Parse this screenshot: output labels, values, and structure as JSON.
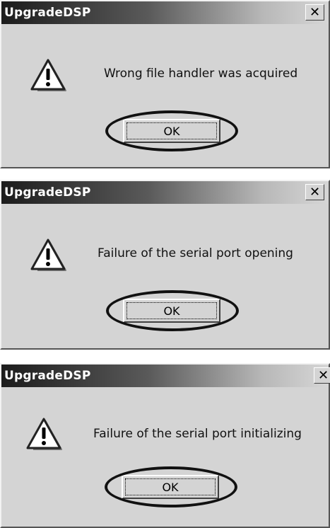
{
  "dialogs": [
    {
      "title": "UpgradeDSP",
      "message": "Wrong file handler was acquired",
      "ok_label": "OK",
      "close_label": "✕"
    },
    {
      "title": "UpgradeDSP",
      "message": "Failure of the serial port opening",
      "ok_label": "OK",
      "close_label": "✕"
    },
    {
      "title": "UpgradeDSP",
      "message": "Failure of the serial port initializing",
      "ok_label": "OK",
      "close_label": "✕"
    }
  ],
  "icons": {
    "warning": "warning-triangle-icon",
    "close": "close-icon"
  },
  "colors": {
    "dialog_bg": "#d4d4d4",
    "title_text": "#ffffff",
    "highlight_ring": "#111111"
  }
}
